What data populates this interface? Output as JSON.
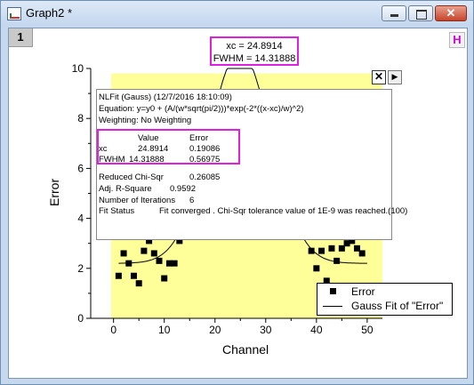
{
  "window": {
    "title": "Graph2 *",
    "layer_number": "1",
    "h_badge": "H",
    "close_glyph": "✕"
  },
  "top_label": {
    "line1": "xc = 24.8914",
    "line2": "FWHM = 14.31888"
  },
  "fit_report": {
    "header": "NLFit (Gauss) (12/7/2016 18:10:09)",
    "equation": "Equation: y=y0 + (A/(w*sqrt(pi/2)))*exp(-2*((x-xc)/w)^2)",
    "weighting": "Weighting: No Weighting",
    "col_value": "Value",
    "col_error": "Error",
    "rows": [
      {
        "name": "xc",
        "value": "24.8914",
        "error": "0.19086"
      },
      {
        "name": "FWHM",
        "value": "14.31888",
        "error": "0.56975"
      }
    ],
    "reduced_chisqr_label": "Reduced Chi-Sqr",
    "reduced_chisqr_value": "0.26085",
    "adj_rsquare_label": "Adj. R-Square",
    "adj_rsquare_value": "0.9592",
    "iterations_label": "Number of Iterations",
    "iterations_value": "6",
    "fit_status_label": "Fit Status",
    "fit_status_value": "Fit converged . Chi-Sqr tolerance value of 1E-9 was reached.(100)",
    "close_glyph": "✕",
    "arrow_glyph": "▶"
  },
  "legend": {
    "items": [
      "Error",
      "Gauss Fit of \"Error\""
    ]
  },
  "colors": {
    "plot_background": "#ffff99",
    "highlight": "#e020e0",
    "marker": "#000000"
  },
  "chart_data": {
    "type": "scatter",
    "xlabel": "Channel",
    "ylabel": "Error",
    "xlim": [
      -4.5,
      53
    ],
    "ylim": [
      0,
      10
    ],
    "x_ticks": [
      0,
      10,
      20,
      30,
      40,
      50
    ],
    "y_ticks": [
      0,
      2,
      4,
      6,
      8,
      10
    ],
    "series": [
      {
        "name": "Error",
        "points": [
          [
            1,
            1.7
          ],
          [
            2,
            2.6
          ],
          [
            3,
            2.2
          ],
          [
            4,
            1.7
          ],
          [
            5,
            1.4
          ],
          [
            6,
            2.7
          ],
          [
            7,
            3.1
          ],
          [
            8,
            2.6
          ],
          [
            9,
            2.3
          ],
          [
            10,
            1.6
          ],
          [
            11,
            2.2
          ],
          [
            12,
            2.2
          ],
          [
            13,
            3.1
          ],
          [
            14,
            3.7
          ],
          [
            15,
            4.3
          ],
          [
            34,
            4.2
          ],
          [
            35,
            3.6
          ],
          [
            36,
            3.8
          ],
          [
            37,
            3.8
          ],
          [
            38,
            3.4
          ],
          [
            39,
            2.7
          ],
          [
            40,
            2.0
          ],
          [
            41,
            2.7
          ],
          [
            42,
            1.5
          ],
          [
            43,
            2.8
          ],
          [
            44,
            2.3
          ],
          [
            45,
            2.8
          ],
          [
            46,
            3.0
          ],
          [
            47,
            3.1
          ],
          [
            48,
            2.8
          ],
          [
            49,
            2.6
          ]
        ]
      },
      {
        "name": "Gauss Fit of \"Error\"",
        "fit": {
          "y0": 2.2,
          "xc": 24.8914,
          "fwhm": 14.31888,
          "peak_height": 8.5
        },
        "x_range": [
          1,
          50
        ]
      }
    ]
  }
}
